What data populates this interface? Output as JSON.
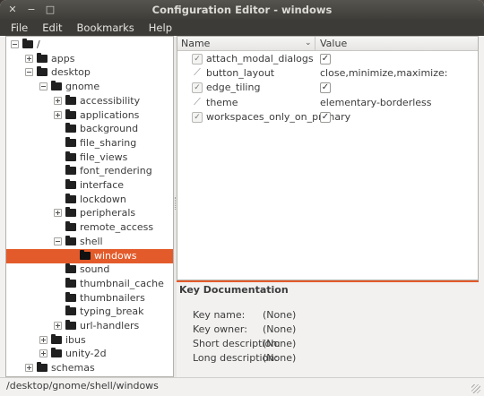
{
  "window": {
    "title": "Configuration Editor - windows",
    "close_glyph": "✕",
    "minimize_glyph": "−",
    "maximize_glyph": "□"
  },
  "menu": [
    "File",
    "Edit",
    "Bookmarks",
    "Help"
  ],
  "tree": [
    {
      "label": "/",
      "depth": 0,
      "expander": "minus"
    },
    {
      "label": "apps",
      "depth": 1,
      "expander": "plus"
    },
    {
      "label": "desktop",
      "depth": 1,
      "expander": "minus"
    },
    {
      "label": "gnome",
      "depth": 2,
      "expander": "minus"
    },
    {
      "label": "accessibility",
      "depth": 3,
      "expander": "plus"
    },
    {
      "label": "applications",
      "depth": 3,
      "expander": "plus"
    },
    {
      "label": "background",
      "depth": 3,
      "expander": "none"
    },
    {
      "label": "file_sharing",
      "depth": 3,
      "expander": "none"
    },
    {
      "label": "file_views",
      "depth": 3,
      "expander": "none"
    },
    {
      "label": "font_rendering",
      "depth": 3,
      "expander": "none"
    },
    {
      "label": "interface",
      "depth": 3,
      "expander": "none"
    },
    {
      "label": "lockdown",
      "depth": 3,
      "expander": "none"
    },
    {
      "label": "peripherals",
      "depth": 3,
      "expander": "plus"
    },
    {
      "label": "remote_access",
      "depth": 3,
      "expander": "none"
    },
    {
      "label": "shell",
      "depth": 3,
      "expander": "minus"
    },
    {
      "label": "windows",
      "depth": 4,
      "expander": "none",
      "selected": true
    },
    {
      "label": "sound",
      "depth": 3,
      "expander": "none"
    },
    {
      "label": "thumbnail_cache",
      "depth": 3,
      "expander": "none"
    },
    {
      "label": "thumbnailers",
      "depth": 3,
      "expander": "none"
    },
    {
      "label": "typing_break",
      "depth": 3,
      "expander": "none"
    },
    {
      "label": "url-handlers",
      "depth": 3,
      "expander": "plus"
    },
    {
      "label": "ibus",
      "depth": 2,
      "expander": "plus"
    },
    {
      "label": "unity-2d",
      "depth": 2,
      "expander": "plus"
    },
    {
      "label": "schemas",
      "depth": 1,
      "expander": "plus"
    }
  ],
  "keys": {
    "headers": {
      "name": "Name",
      "value": "Value"
    },
    "rows": [
      {
        "name": "attach_modal_dialogs",
        "type": "bool",
        "value": "✓"
      },
      {
        "name": "button_layout",
        "type": "string",
        "value": "close,minimize,maximize:"
      },
      {
        "name": "edge_tiling",
        "type": "bool",
        "value": "✓"
      },
      {
        "name": "theme",
        "type": "string",
        "value": "elementary-borderless"
      },
      {
        "name": "workspaces_only_on_primary",
        "type": "bool",
        "value": "✓"
      }
    ]
  },
  "doc": {
    "title": "Key Documentation",
    "fields": [
      {
        "label": "Key name:",
        "value": "(None)"
      },
      {
        "label": "Key owner:",
        "value": "(None)"
      },
      {
        "label": "Short description:",
        "value": "(None)"
      },
      {
        "label": "Long description:",
        "value": "(None)"
      }
    ]
  },
  "status": {
    "path": "/desktop/gnome/shell/windows"
  },
  "colors": {
    "accent": "#e45b2b",
    "titlebar": "#3c3b37"
  }
}
